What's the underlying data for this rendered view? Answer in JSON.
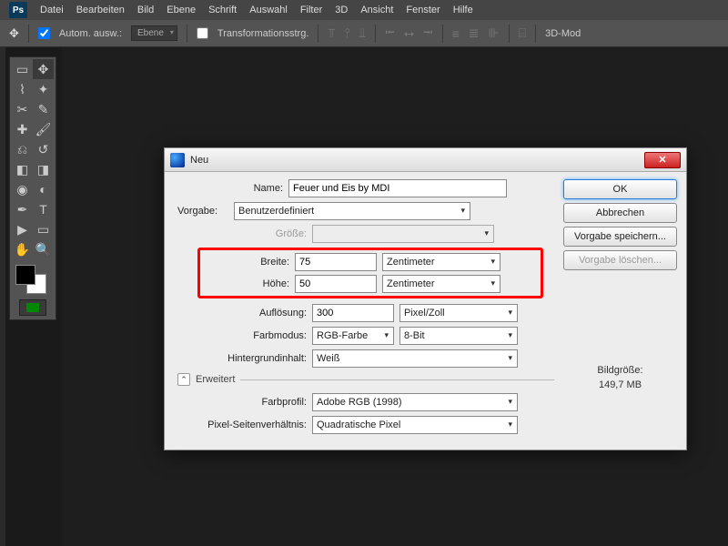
{
  "app": {
    "logo": "Ps"
  },
  "menu": [
    "Datei",
    "Bearbeiten",
    "Bild",
    "Ebene",
    "Schrift",
    "Auswahl",
    "Filter",
    "3D",
    "Ansicht",
    "Fenster",
    "Hilfe"
  ],
  "options_bar": {
    "auto_select_label": "Autom. ausw.:",
    "target_dropdown": "Ebene",
    "transform_controls_label": "Transformationsstrg.",
    "mode3d_label": "3D-Mod"
  },
  "dialog": {
    "title": "Neu",
    "name_label": "Name:",
    "name_value": "Feuer und Eis by MDI",
    "preset_label": "Vorgabe:",
    "preset_value": "Benutzerdefiniert",
    "size_label": "Größe:",
    "width_label": "Breite:",
    "width_value": "75",
    "width_unit": "Zentimeter",
    "height_label": "Höhe:",
    "height_value": "50",
    "height_unit": "Zentimeter",
    "resolution_label": "Auflösung:",
    "resolution_value": "300",
    "resolution_unit": "Pixel/Zoll",
    "colormode_label": "Farbmodus:",
    "colormode_value": "RGB-Farbe",
    "colordepth_value": "8-Bit",
    "bgcontent_label": "Hintergrundinhalt:",
    "bgcontent_value": "Weiß",
    "advanced_label": "Erweitert",
    "colorprofile_label": "Farbprofil:",
    "colorprofile_value": "Adobe RGB (1998)",
    "pixelar_label": "Pixel-Seitenverhältnis:",
    "pixelar_value": "Quadratische Pixel",
    "buttons": {
      "ok": "OK",
      "cancel": "Abbrechen",
      "save_preset": "Vorgabe speichern...",
      "delete_preset": "Vorgabe löschen..."
    },
    "image_size_label": "Bildgröße:",
    "image_size_value": "149,7 MB"
  }
}
